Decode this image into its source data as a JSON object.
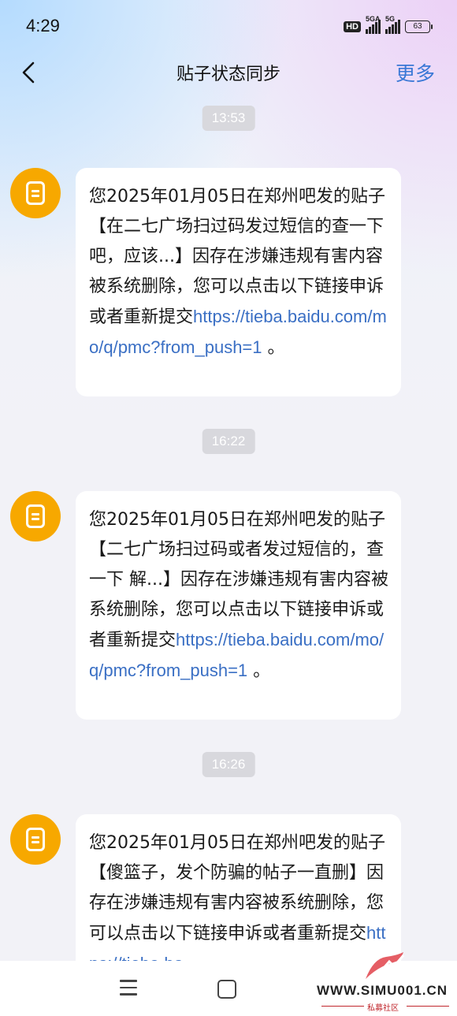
{
  "status_bar": {
    "time": "4:29",
    "hd": "HD",
    "signal1": "5GA",
    "signal2": "5G",
    "battery": "63"
  },
  "header": {
    "title": "贴子状态同步",
    "more": "更多"
  },
  "messages": [
    {
      "time": "13:53",
      "text": "您2025年01月05日在郑州吧发的贴子【在二七广场扫过码发过短信的查一下吧，应该...】因存在涉嫌违规有害内容被系统删除，您可以点击以下链接申诉或者重新提交",
      "link": "https://tieba.baidu.com/mo/q/pmc?from_push=1",
      "tail": " 。"
    },
    {
      "time": "16:22",
      "text": "您2025年01月05日在郑州吧发的贴子【二七广场扫过码或者发过短信的，查一下 解...】因存在涉嫌违规有害内容被系统删除，您可以点击以下链接申诉或者重新提交",
      "link": "https://tieba.baidu.com/mo/q/pmc?from_push=1",
      "tail": " 。"
    },
    {
      "time": "16:26",
      "text": "您2025年01月05日在郑州吧发的贴子【傻篮子，发个防骗的帖子一直删】因存在涉嫌违规有害内容被系统删除，您可以点击以下链接申诉或者重新提交",
      "link": "https://tieba.ba"
    }
  ],
  "watermark": {
    "site": "WWW.SIMU001.CN",
    "sub": "私募社区"
  },
  "colors": {
    "accent": "#3a78d6",
    "link": "#3a6fc4",
    "avatar": "#f7a800"
  }
}
